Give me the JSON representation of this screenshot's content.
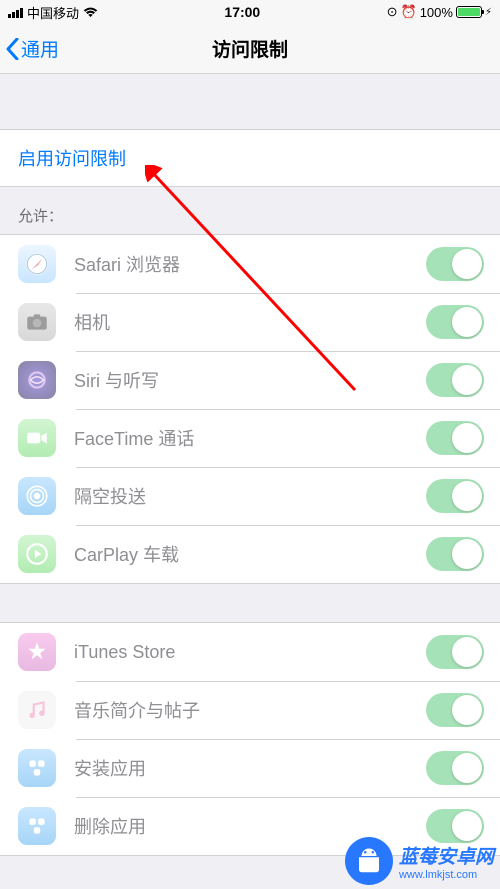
{
  "statusBar": {
    "carrier": "中国移动",
    "time": "17:00",
    "battery": "100%"
  },
  "nav": {
    "back": "通用",
    "title": "访问限制"
  },
  "enable": {
    "label": "启用访问限制"
  },
  "section1": {
    "header": "允许：",
    "items": [
      {
        "name": "safari",
        "label": "Safari 浏览器"
      },
      {
        "name": "camera",
        "label": "相机"
      },
      {
        "name": "siri",
        "label": "Siri 与听写"
      },
      {
        "name": "facetime",
        "label": "FaceTime 通话"
      },
      {
        "name": "airdrop",
        "label": "隔空投送"
      },
      {
        "name": "carplay",
        "label": "CarPlay 车载"
      }
    ]
  },
  "section2": {
    "items": [
      {
        "name": "itunes",
        "label": "iTunes Store"
      },
      {
        "name": "music",
        "label": "音乐简介与帖子"
      },
      {
        "name": "install",
        "label": "安装应用"
      },
      {
        "name": "delete",
        "label": "删除应用"
      }
    ]
  },
  "watermark": {
    "title": "蓝莓安卓网",
    "url": "www.lmkjst.com"
  }
}
